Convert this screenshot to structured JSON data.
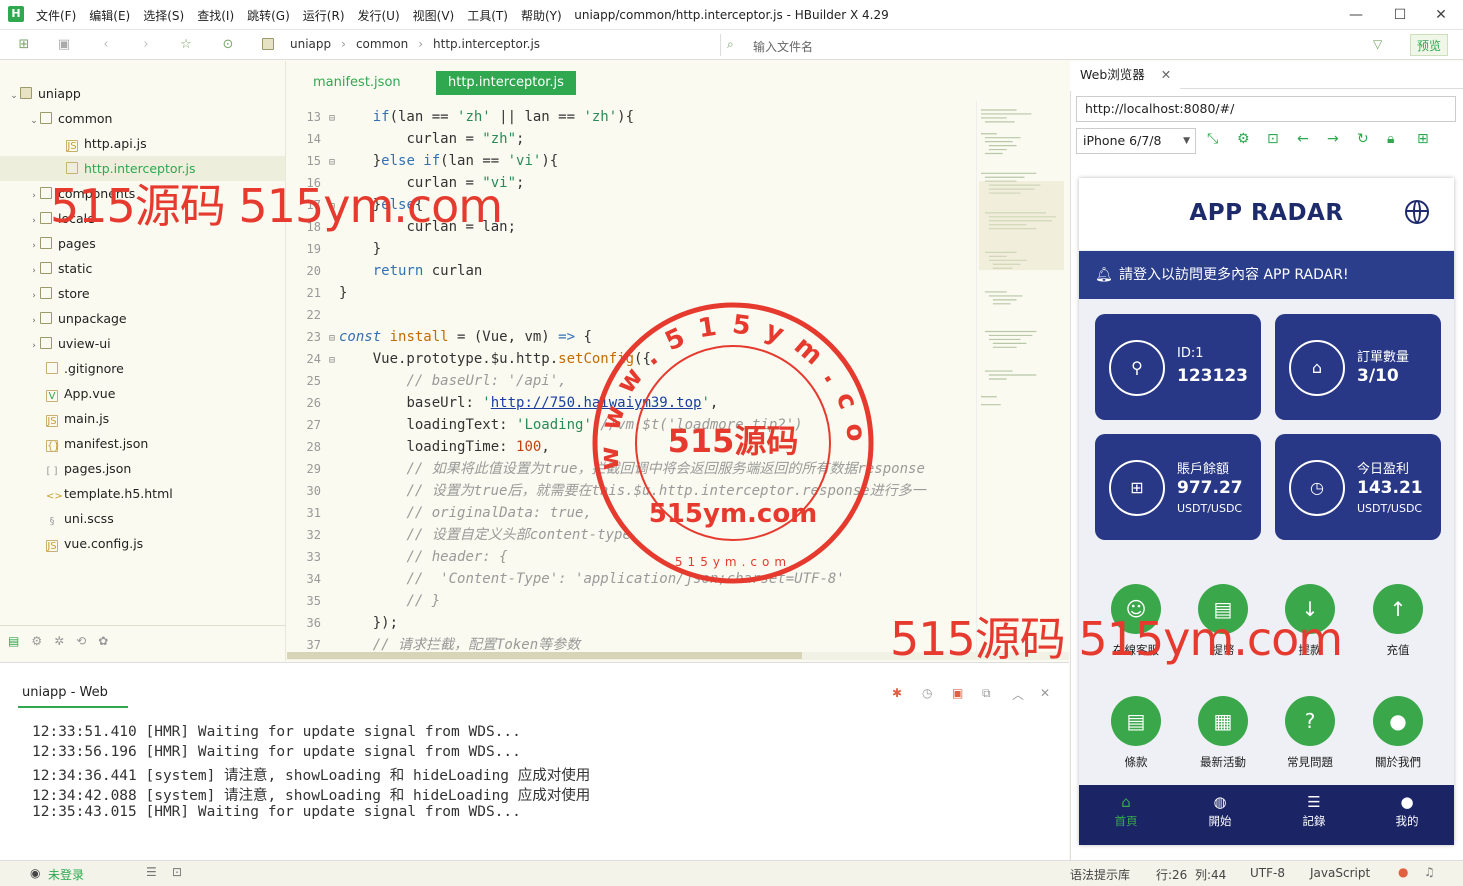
{
  "window": {
    "title": "uniapp/common/http.interceptor.js - HBuilder X 4.29",
    "logo": "H",
    "menus": [
      "文件(F)",
      "编辑(E)",
      "选择(S)",
      "查找(I)",
      "跳转(G)",
      "运行(R)",
      "发行(U)",
      "视图(V)",
      "工具(T)",
      "帮助(Y)"
    ],
    "breadcrumbs": [
      "uniapp",
      "common",
      "http.interceptor.js"
    ],
    "file_search_placeholder": "输入文件名",
    "preview_label": "预览"
  },
  "sidebar": {
    "items": [
      {
        "label": "uniapp"
      },
      {
        "label": "common"
      },
      {
        "label": "http.api.js"
      },
      {
        "label": "http.interceptor.js"
      },
      {
        "label": "components"
      },
      {
        "label": "locale"
      },
      {
        "label": "pages"
      },
      {
        "label": "static"
      },
      {
        "label": "store"
      },
      {
        "label": "unpackage"
      },
      {
        "label": "uview-ui"
      },
      {
        "label": ".gitignore"
      },
      {
        "label": "App.vue"
      },
      {
        "label": "main.js"
      },
      {
        "label": "manifest.json"
      },
      {
        "label": "pages.json"
      },
      {
        "label": "template.h5.html"
      },
      {
        "label": "uni.scss"
      },
      {
        "label": "vue.config.js"
      }
    ]
  },
  "editor": {
    "tabs": [
      "manifest.json",
      "http.interceptor.js"
    ],
    "line_numbers": [
      "13",
      "14",
      "15",
      "16",
      "17",
      "18",
      "19",
      "20",
      "21",
      "22",
      "23",
      "24",
      "25",
      "26",
      "27",
      "28",
      "29",
      "30",
      "31",
      "32",
      "33",
      "34",
      "35",
      "36",
      "37"
    ]
  },
  "console": {
    "title": "uniapp - Web",
    "lines": [
      "12:33:51.410 [HMR] Waiting for update signal from WDS...",
      "12:33:56.196 [HMR] Waiting for update signal from WDS...",
      "12:34:36.441 [system] 请注意, showLoading 和 hideLoading 应成对使用",
      "12:34:42.088 [system] 请注意, showLoading 和 hideLoading 应成对使用",
      "12:35:43.015 [HMR] Waiting for update signal from WDS..."
    ]
  },
  "statusbar": {
    "login": "未登录",
    "syntax": "语法提示库",
    "position": "行:26  列:44",
    "encoding": "UTF-8",
    "language": "JavaScript"
  },
  "webview": {
    "tab": "Web浏览器",
    "url": "http://localhost:8080/#/",
    "device": "iPhone 6/7/8"
  },
  "app": {
    "title": "APP RADAR",
    "notice": "請登入以訪問更多內容 APP RADAR!",
    "cards": [
      {
        "label": "ID:1",
        "value": "123123",
        "unit": ""
      },
      {
        "label": "訂單數量",
        "value": "3/10",
        "unit": ""
      },
      {
        "label": "賬戶餘額",
        "value": "977.27",
        "unit": "USDT/USDC"
      },
      {
        "label": "今日盈利",
        "value": "143.21",
        "unit": "USDT/USDC"
      }
    ],
    "actions": [
      {
        "label": "在線客服"
      },
      {
        "label": "提幣"
      },
      {
        "label": "提款"
      },
      {
        "label": "充值"
      },
      {
        "label": "條款"
      },
      {
        "label": "最新活動"
      },
      {
        "label": "常見問題"
      },
      {
        "label": "關於我們"
      }
    ],
    "nav": [
      {
        "label": "首頁"
      },
      {
        "label": "開始"
      },
      {
        "label": "記錄"
      },
      {
        "label": "我的"
      }
    ]
  },
  "watermark": {
    "text1": "515源码 515ym.com",
    "text2": "515源码 515ym.com",
    "stamp_text": "515源码",
    "stamp_url": "515ym.com",
    "stamp_ring": "www.515ym.com",
    "stamp_small": "515ym.com"
  }
}
